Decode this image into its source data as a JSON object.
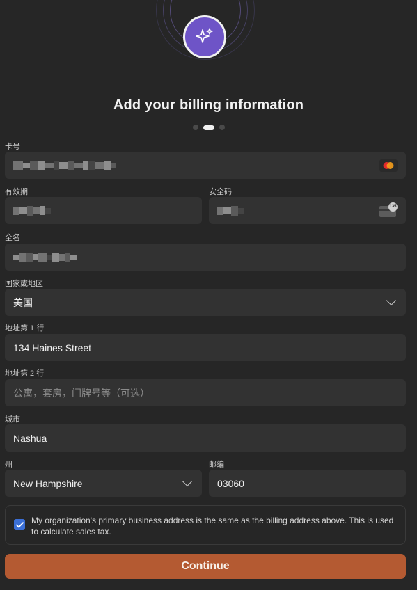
{
  "header": {
    "title": "Add your billing information",
    "steps_total": 3,
    "step_active": 2
  },
  "form": {
    "card_number": {
      "label": "卡号",
      "brand_icon": "mastercard-icon"
    },
    "expiry": {
      "label": "有效期"
    },
    "cvc": {
      "label": "安全码",
      "icon": "card-back-icon",
      "icon_text": "135"
    },
    "full_name": {
      "label": "全名"
    },
    "country": {
      "label": "国家或地区",
      "value": "美国"
    },
    "address1": {
      "label": "地址第 1 行",
      "value": "134 Haines Street"
    },
    "address2": {
      "label": "地址第 2 行",
      "placeholder": "公寓，套房，门牌号等（可选）"
    },
    "city": {
      "label": "城市",
      "value": "Nashua"
    },
    "state": {
      "label": "州",
      "value": "New Hampshire"
    },
    "postal": {
      "label": "邮编",
      "value": "03060"
    },
    "same_address": {
      "checked": true,
      "text": "My organization's primary business address is the same as the billing address above. This is used to calculate sales tax."
    }
  },
  "actions": {
    "continue_label": "Continue"
  },
  "colors": {
    "accent": "#b45a32",
    "badge": "#6e54c7",
    "checkbox": "#3b6fd6",
    "background": "#262626",
    "field": "#323232"
  }
}
